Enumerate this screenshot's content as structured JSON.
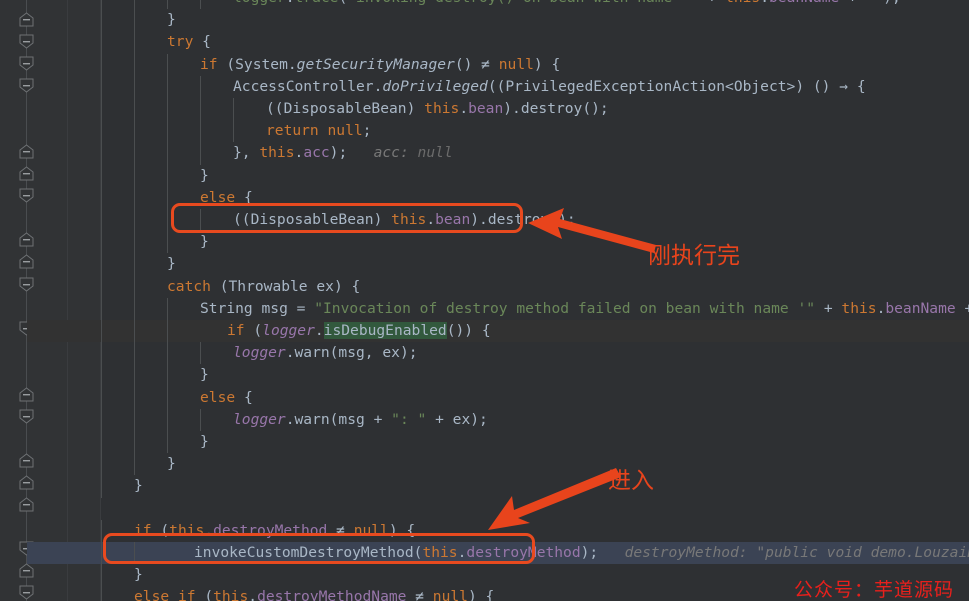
{
  "editor": {
    "theme": "darcula",
    "background": "#2e3033",
    "gutter_background": "#313335",
    "default_text_color": "#a9b7c6",
    "keyword_color": "#cc7832",
    "string_color": "#6a8759",
    "field_color": "#9876aa",
    "inline_hint_color": "#787878",
    "current_line_highlight_color": "#3b4354",
    "search_match_color": "#32593d"
  },
  "annotations": {
    "accent_color": "#e8441c",
    "watermark_color": "#e8201c",
    "callout_1": "刚执行完",
    "callout_2": "进入",
    "watermark": "公众号：芋道源码"
  },
  "code": {
    "language": "Java",
    "lines": [
      {
        "n": 1,
        "indent": 4,
        "text": "logger.trace( invoking destroy() on bean with name    + this.beanName +   );",
        "clipped_top": true
      },
      {
        "n": 2,
        "indent": 2,
        "text": "}"
      },
      {
        "n": 3,
        "indent": 2,
        "text": "try {"
      },
      {
        "n": 4,
        "indent": 3,
        "text": "if (System.getSecurityManager() ≠ null) {"
      },
      {
        "n": 5,
        "indent": 4,
        "text": "AccessController.doPrivileged((PrivilegedExceptionAction<Object>) () → {"
      },
      {
        "n": 6,
        "indent": 5,
        "text": "((DisposableBean) this.bean).destroy();"
      },
      {
        "n": 7,
        "indent": 5,
        "text": "return null;"
      },
      {
        "n": 8,
        "indent": 4,
        "text": "}, this.acc);   acc: null"
      },
      {
        "n": 9,
        "indent": 3,
        "text": "}"
      },
      {
        "n": 10,
        "indent": 3,
        "text": "else {"
      },
      {
        "n": 11,
        "indent": 4,
        "text": "((DisposableBean) this.bean).destroy();",
        "boxed": true
      },
      {
        "n": 12,
        "indent": 3,
        "text": "}"
      },
      {
        "n": 13,
        "indent": 2,
        "text": "}"
      },
      {
        "n": 14,
        "indent": 2,
        "text": "catch (Throwable ex) {"
      },
      {
        "n": 15,
        "indent": 3,
        "text": "String msg = \"Invocation of destroy method failed on bean with name '\" + this.beanName + \"'\";   beanNa"
      },
      {
        "n": 16,
        "indent": 3,
        "text": "if (logger.isDebugEnabled()) {",
        "highlight": "debug"
      },
      {
        "n": 17,
        "indent": 4,
        "text": "logger.warn(msg, ex);"
      },
      {
        "n": 18,
        "indent": 3,
        "text": "}"
      },
      {
        "n": 19,
        "indent": 3,
        "text": "else {"
      },
      {
        "n": 20,
        "indent": 4,
        "text": "logger.warn(msg + \": \" + ex);"
      },
      {
        "n": 21,
        "indent": 3,
        "text": "}"
      },
      {
        "n": 22,
        "indent": 2,
        "text": "}"
      },
      {
        "n": 23,
        "indent": 1,
        "text": "}"
      },
      {
        "n": 24,
        "indent": 0,
        "text": ""
      },
      {
        "n": 25,
        "indent": 1,
        "text": "if (this.destroyMethod ≠ null) {"
      },
      {
        "n": 26,
        "indent": 2,
        "text": "invokeCustomDestroyMethod(this.destroyMethod);   destroyMethod: \"public void demo.LouzaiBean.destroyMethod",
        "highlight": "exec",
        "boxed": true
      },
      {
        "n": 27,
        "indent": 1,
        "text": "}"
      },
      {
        "n": 28,
        "indent": 1,
        "text": "else if (this.destroyMethodName ≠ null) {"
      }
    ]
  }
}
